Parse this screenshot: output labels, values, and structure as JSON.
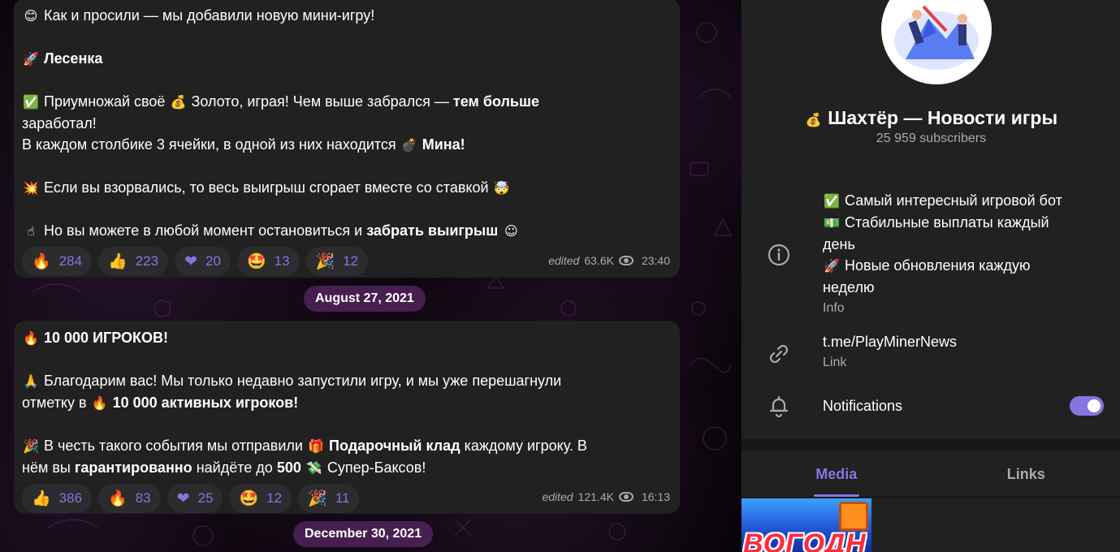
{
  "post1": {
    "lines": [
      {
        "emoji": "😊",
        "text": "Как и просили — мы добавили новую мини-игру!"
      },
      {
        "emoji": "",
        "text": ""
      },
      {
        "emoji": "🚀",
        "bold": "Лесенка"
      },
      {
        "emoji": "",
        "text": ""
      },
      {
        "emoji": "✅",
        "text": "Приумножай своё",
        "emoji2": "💰",
        "text2": "Золото, играя! Чем выше забрался —",
        "bold": "тем больше"
      },
      {
        "text": "заработал!"
      },
      {
        "text": "В каждом столбике 3 ячейки, в одной из них находится",
        "emoji2": "💣",
        "bold": "Мина!"
      },
      {
        "emoji": "",
        "text": ""
      },
      {
        "emoji": "💥",
        "text": "Если вы взорвались, то весь выигрыш сгорает вместе со ставкой",
        "emoji3": "🤯"
      },
      {
        "emoji": "",
        "text": ""
      },
      {
        "emoji": "☝",
        "text": "Но вы можете в любой момент остановиться и",
        "bold": "забрать выигрыш",
        "emoji3": "☺"
      }
    ],
    "reactions": [
      {
        "emoji": "🔥",
        "count": "284"
      },
      {
        "emoji": "👍",
        "count": "223"
      },
      {
        "emoji": "❤",
        "count": "20"
      },
      {
        "emoji": "🤩",
        "count": "13"
      },
      {
        "emoji": "🎉",
        "count": "12"
      }
    ],
    "edited": "edited",
    "views": "63.6K",
    "time": "23:40"
  },
  "date1": "August 27, 2021",
  "post2": {
    "lines": [
      {
        "emoji": "🔥",
        "bold": "10 000 ИГРОКОВ!"
      },
      {
        "emoji": "",
        "text": ""
      },
      {
        "emoji": "🙏",
        "text": "Благодарим вас! Мы только недавно запустили игру, и мы уже перешагнули"
      },
      {
        "text": "отметку в",
        "emoji2": "🔥",
        "bold": "10 000 активных игроков!"
      },
      {
        "emoji": "",
        "text": ""
      },
      {
        "emoji": "🎉",
        "text": "В честь такого события мы отправили",
        "emoji2": "🎁",
        "bold": "Подарочный клад",
        "text3": "каждому игроку. В"
      },
      {
        "text": "нём вы",
        "bold": "гарантированно",
        "text3": "найдёте до",
        "bold2": "500",
        "emoji3": "💸",
        "text4": "Супер-Баксов!"
      }
    ],
    "reactions": [
      {
        "emoji": "👍",
        "count": "386"
      },
      {
        "emoji": "🔥",
        "count": "83"
      },
      {
        "emoji": "❤",
        "count": "25"
      },
      {
        "emoji": "🤩",
        "count": "12"
      },
      {
        "emoji": "🎉",
        "count": "11"
      }
    ],
    "edited": "edited",
    "views": "121.4K",
    "time": "16:13"
  },
  "date2": "December 30, 2021",
  "channel": {
    "title_emoji": "💰",
    "title": "Шахтёр — Новости игры",
    "subscribers": "25 959 subscribers",
    "info_lines": [
      {
        "emoji": "✅",
        "text": "Самый интересный игровой бот"
      },
      {
        "emoji": "💵",
        "text": "Стабильные выплаты каждый"
      },
      {
        "emoji": "",
        "text": "день"
      },
      {
        "emoji": "🚀",
        "text": "Новые обновления каждую"
      },
      {
        "emoji": "",
        "text": "неделю"
      }
    ],
    "info_label": "Info",
    "link": "t.me/PlayMinerNews",
    "link_label": "Link",
    "notifications_label": "Notifications",
    "notifications_on": true,
    "accent": "#8774e1"
  },
  "tabs": [
    {
      "label": "Media",
      "active": true
    },
    {
      "label": "Links",
      "active": false
    }
  ],
  "media_thumb_text": "ВОГОДН"
}
